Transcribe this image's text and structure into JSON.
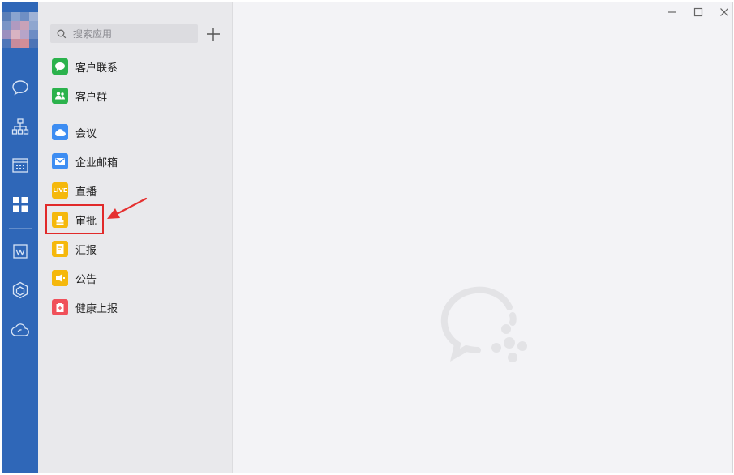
{
  "search": {
    "placeholder": "搜索应用"
  },
  "icons": {
    "rail": [
      "chat-icon",
      "org-chart-icon",
      "calendar-icon",
      "apps-grid-icon",
      "doc-icon",
      "cube-icon",
      "cloud-icon"
    ],
    "search": "magnifier-icon",
    "add": "plus-icon",
    "watermark": "wecom-logo-icon"
  },
  "apps": {
    "group1": [
      {
        "label": "客户联系",
        "color": "#2bb24c",
        "icon": "chat-bubble-icon"
      },
      {
        "label": "客户群",
        "color": "#2bb24c",
        "icon": "group-icon"
      }
    ],
    "group2": [
      {
        "label": "会议",
        "color": "#3d8df2",
        "icon": "cloud-meeting-icon"
      },
      {
        "label": "企业邮箱",
        "color": "#3d8df2",
        "icon": "mail-icon"
      },
      {
        "label": "直播",
        "color": "#f5b80c",
        "icon": "live-icon",
        "badge": "LIVE"
      },
      {
        "label": "审批",
        "color": "#f5b80c",
        "icon": "stamp-icon"
      },
      {
        "label": "汇报",
        "color": "#f5b80c",
        "icon": "report-icon"
      },
      {
        "label": "公告",
        "color": "#f5b80c",
        "icon": "megaphone-icon"
      },
      {
        "label": "健康上报",
        "color": "#f0505a",
        "icon": "health-icon"
      }
    ]
  },
  "colors": {
    "rail": "#2f67b8",
    "highlight": "#e12a2a",
    "arrow": "#e53030"
  }
}
